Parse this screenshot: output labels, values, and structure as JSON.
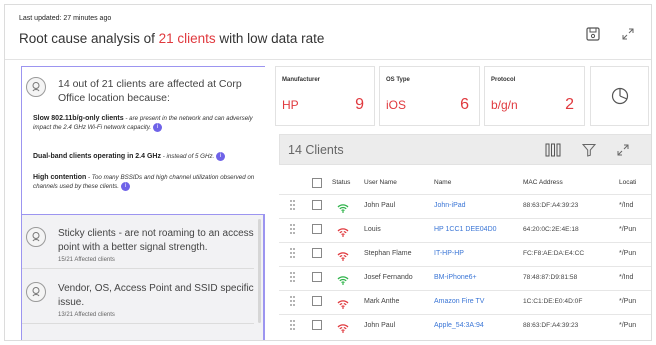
{
  "header": {
    "updated": "Last updated: 27 minutes ago",
    "title_prefix": "Root cause analysis of ",
    "title_count": "21 clients",
    "title_suffix": " with low data rate"
  },
  "summary": {
    "heading": "14 out of 21 clients are affected at Corp Office location because:",
    "causes": [
      {
        "bold": "Slow 802.11b/g-only clients",
        "text": " - are present in the network and can adversely impact the 2.4 GHz Wi-Fi network capacity."
      },
      {
        "bold": "Dual-band clients operating in 2.4 GHz",
        "text": " - instead of 5 GHz."
      },
      {
        "bold": "High contention",
        "text": " - Too many BSSIDs and high channel utilization observed on channels used by these clients."
      }
    ]
  },
  "issues": [
    {
      "title": "Sticky clients - are not roaming to an access point with a better signal strength.",
      "sub": "15/21 Affected clients"
    },
    {
      "title": "Vendor, OS, Access Point and SSID specific issue.",
      "sub": "13/21 Affected clients"
    }
  ],
  "stats": [
    {
      "label": "Manufacturer",
      "name": "HP",
      "value": "9"
    },
    {
      "label": "OS Type",
      "name": "iOS",
      "value": "6"
    },
    {
      "label": "Protocol",
      "name": "b/g/n",
      "value": "2"
    }
  ],
  "table": {
    "title": "14 Clients",
    "columns": [
      "Status",
      "User Name",
      "Name",
      "MAC Address",
      "Locati"
    ],
    "rows": [
      {
        "status": "good",
        "user": "John Paul",
        "name": "John-iPad",
        "mac": "88:63:DF:A4:39:23",
        "loc": "*/Ind"
      },
      {
        "status": "bad",
        "user": "Louis",
        "name": "HP 1CC1 DEE04D0",
        "mac": "64:20:0C:2E:4E:18",
        "loc": "*/Pun"
      },
      {
        "status": "bad",
        "user": "Stephan Flame",
        "name": "IT-HP-HP",
        "mac": "FC:F8:AE:DA:E4:CC",
        "loc": "*/Pun"
      },
      {
        "status": "good",
        "user": "Josef Fernando",
        "name": "BM-iPhone6+",
        "mac": "78:48:87:D9:81:58",
        "loc": "*/Ind"
      },
      {
        "status": "bad",
        "user": "Mark Anthe",
        "name": "Amazon Fire TV",
        "mac": "1C:C1:DE:E0:4D:0F",
        "loc": "*/Pun"
      },
      {
        "status": "bad",
        "user": "John Paul",
        "name": "Apple_54:3A:94",
        "mac": "88:63:DF:A4:39:23",
        "loc": "*/Pun"
      }
    ]
  },
  "colors": {
    "accent": "#e0393e",
    "link": "#3b76d6",
    "good": "#2fb34a",
    "bad": "#e0393e",
    "focus": "#9c95f0"
  },
  "icons": [
    "save-icon",
    "expand-icon",
    "root-cause-icon",
    "info-icon",
    "pie-chart-icon",
    "columns-icon",
    "filter-icon",
    "wifi-icon",
    "wifi-error-icon",
    "drag-handle-icon"
  ]
}
